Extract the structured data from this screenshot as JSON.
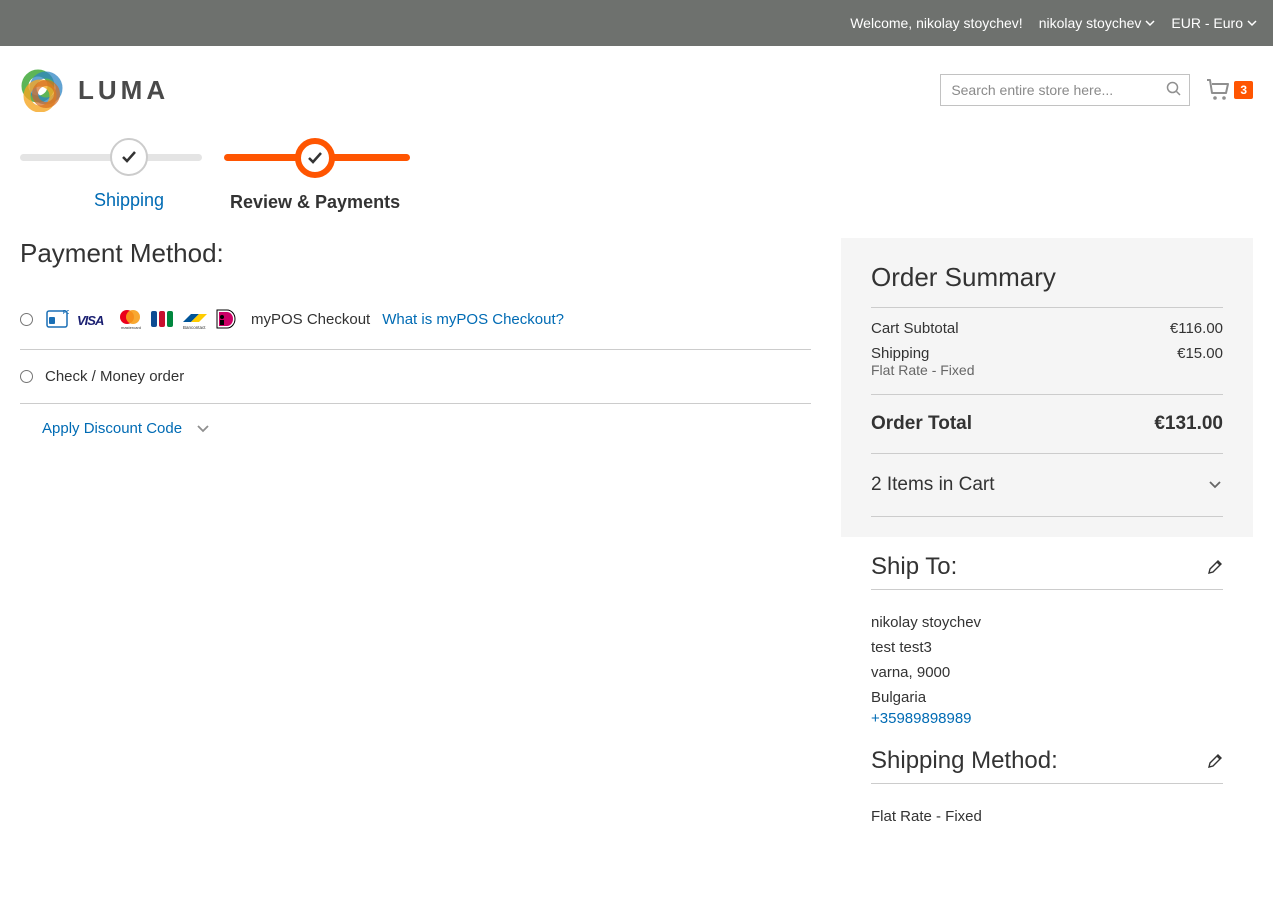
{
  "top_bar": {
    "welcome": "Welcome, nikolay stoychev!",
    "user_menu": "nikolay stoychev",
    "currency": "EUR - Euro"
  },
  "header": {
    "logo_text": "LUMA",
    "search_placeholder": "Search entire store here...",
    "cart_count": "3"
  },
  "progress": {
    "step1_label": "Shipping",
    "step2_label": "Review & Payments"
  },
  "payment": {
    "title": "Payment Method:",
    "options": [
      {
        "label": "myPOS Checkout",
        "help_link": "What is myPOS Checkout?"
      },
      {
        "label": "Check / Money order"
      }
    ],
    "discount_label": "Apply Discount Code"
  },
  "summary": {
    "title": "Order Summary",
    "subtotal_label": "Cart Subtotal",
    "subtotal_value": "€116.00",
    "shipping_label": "Shipping",
    "shipping_value": "€15.00",
    "shipping_sub": "Flat Rate - Fixed",
    "total_label": "Order Total",
    "total_value": "€131.00",
    "items_toggle": "2 Items in Cart"
  },
  "ship_to": {
    "title": "Ship To:",
    "name": "nikolay stoychev",
    "street": "test test3",
    "city": "varna, 9000",
    "country": "Bulgaria",
    "phone": "+35989898989"
  },
  "ship_method": {
    "title": "Shipping Method:",
    "value": "Flat Rate - Fixed"
  }
}
